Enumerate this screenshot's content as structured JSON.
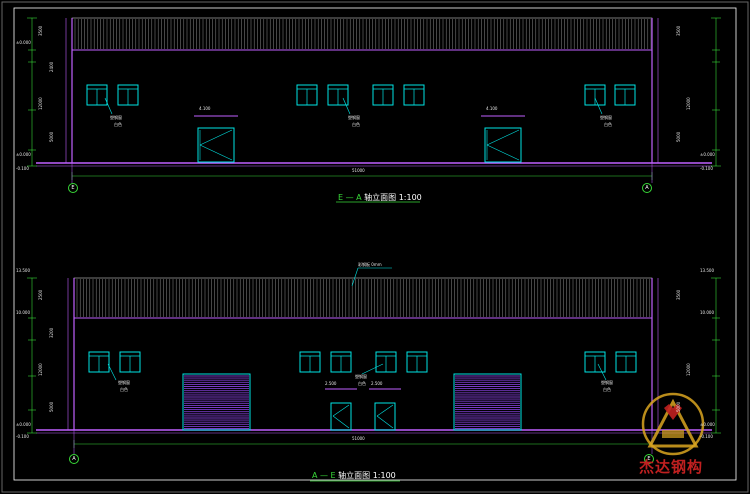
{
  "upper_view": {
    "title_axes": "E — A",
    "title_text": "轴立面图",
    "title_scale": "1:100",
    "left_axis": "E",
    "right_axis": "A",
    "total_dim": "51000",
    "door_lintel_left": "4.100",
    "door_lintel_right": "4.100",
    "window_note": "塑钢窗",
    "window_note2": "白色",
    "elev_top": "±0.000",
    "elev_left": [
      "±0.000",
      "-0.100"
    ],
    "elev_right": [
      "±0.000",
      "-0.100"
    ],
    "vert_dims_left": [
      "3500",
      "2400",
      "12000",
      "5000"
    ],
    "vert_dims_right": [
      "3500",
      "12000",
      "5000"
    ]
  },
  "lower_view": {
    "title_axes": "A — E",
    "title_text": "轴立面图",
    "title_scale": "1:100",
    "left_axis": "A",
    "right_axis": "E",
    "total_dim": "51000",
    "roof_note": "彩钢板 0mm",
    "door_lintel_left": "2.500",
    "door_lintel_right": "2.500",
    "window_note": "塑钢窗",
    "window_note2": "白色",
    "elev_top_left": "13.500",
    "elev_top_right": "13.500",
    "elev_mid_left": "10.000",
    "elev_mid_right": "10.000",
    "elev_bot_left": [
      "±0.000",
      "-0.100"
    ],
    "elev_bot_right": [
      "±0.000",
      "-0.100"
    ],
    "vert_dims_left": [
      "2500",
      "3200",
      "12000",
      "5000"
    ],
    "vert_dims_right": [
      "3500",
      "12000",
      "5000"
    ]
  },
  "watermark": {
    "text": "杰达钢构"
  },
  "colors": {
    "background": "#000000",
    "frame": "#ffffff",
    "wall_outline": "#c060ff",
    "window": "#00e5e5",
    "door": "#00e5e5",
    "roof_siding": "#c8c8c8",
    "dimension": "#38d838",
    "rolling_door": "#7a3cc8",
    "grade_line": "#c060ff",
    "logo_gold": "#d9a520",
    "logo_red": "#c02020"
  }
}
